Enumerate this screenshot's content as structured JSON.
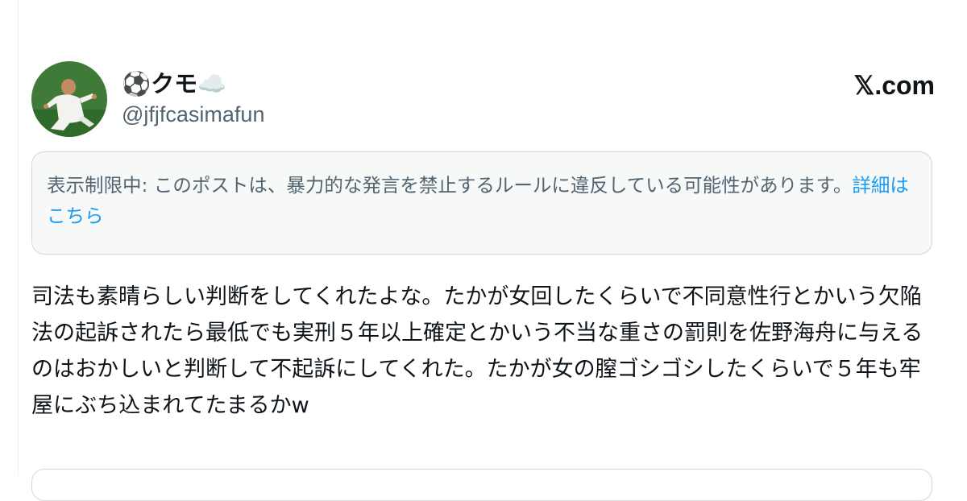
{
  "post": {
    "display_name": "⚽クモ☁️",
    "handle": "@jfjfcasimafun",
    "brand": "𝕏.com",
    "notice_text": "表示制限中: このポストは、暴力的な発言を禁止するルールに違反している可能性があります。",
    "notice_link": "詳細はこちら",
    "body": "司法も素晴らしい判断をしてくれたよな。たかが女回したくらいで不同意性行とかいう欠陥法の起訴されたら最低でも実刑５年以上確定とかいう不当な重さの罰則を佐野海舟に与えるのはおかしいと判断して不起訴にしてくれた。たかが女の膣ゴシゴシしたくらいで５年も牢屋にぶち込まれてたまるかw"
  },
  "colors": {
    "text_primary": "#0f1419",
    "text_secondary": "#536471",
    "link": "#1d9bf0",
    "notice_bg": "#f7f9f9",
    "border": "#cfd9de"
  },
  "icons": {
    "avatar": "player-photo-avatar"
  }
}
